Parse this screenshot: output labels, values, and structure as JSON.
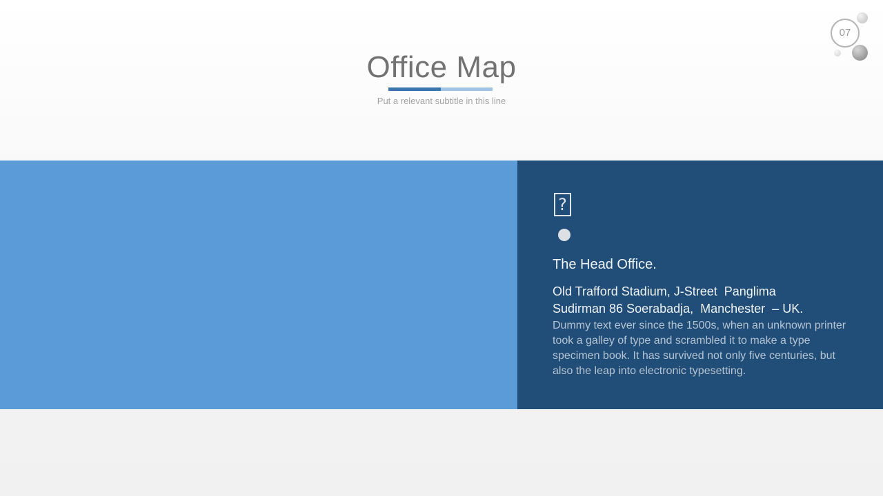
{
  "header": {
    "title": "Office Map",
    "subtitle": "Put a relevant subtitle in this line",
    "accent_dark": "#3b75ad",
    "accent_light": "#9fc4e6"
  },
  "page_badge": {
    "number": "07"
  },
  "map_panel": {
    "color": "#5b9bd7"
  },
  "info_panel": {
    "color": "#214e78",
    "icon": "missing-image-icon",
    "marker": "pin-dot-icon",
    "heading": "The Head Office.",
    "address_line1": "Old Trafford Stadium, J-Street  Panglima",
    "address_line2": "Sudirman 86 Soerabadja,  Manchester  – UK.",
    "description": "Dummy text ever since the 1500s, when an unknown printer took a galley of type and scrambled it to make a type specimen book. It has survived not only five centuries, but also the leap into electronic typesetting."
  }
}
